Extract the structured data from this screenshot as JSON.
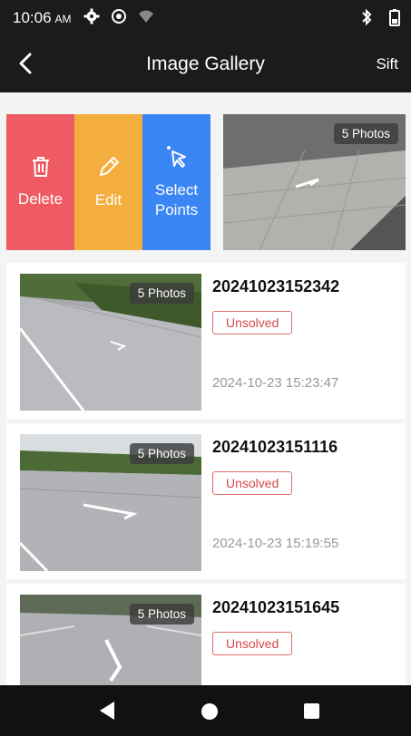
{
  "status_bar": {
    "time": "10:06",
    "ampm": "AM",
    "icons": [
      "gear-icon",
      "record-icon",
      "wifi-icon",
      "bluetooth-icon",
      "battery-icon"
    ]
  },
  "app_bar": {
    "title": "Image Gallery",
    "back_icon": "back-arrow-icon",
    "sift_label": "Sift"
  },
  "swipe_item": {
    "actions": [
      {
        "label": "Delete",
        "icon": "trash-icon",
        "color": "#ef5b62"
      },
      {
        "label": "Edit",
        "icon": "pencil-icon",
        "color": "#f4ae3d"
      },
      {
        "label": "Select\nPoints",
        "label_line1": "Select",
        "label_line2": "Points",
        "icon": "pointer-icon",
        "color": "#3a86f4"
      }
    ],
    "badge": "5 Photos"
  },
  "items": [
    {
      "code": "20241023152342",
      "status": "Unsolved",
      "time": "2024-10-23 15:23:47",
      "badge": "5 Photos"
    },
    {
      "code": "20241023151116",
      "status": "Unsolved",
      "time": "2024-10-23 15:19:55",
      "badge": "5 Photos"
    },
    {
      "code": "20241023151645",
      "status": "Unsolved",
      "time": "",
      "badge": "5 Photos"
    }
  ],
  "nav_bar": {
    "icons": [
      "back-triangle-icon",
      "home-circle-icon",
      "recents-square-icon"
    ]
  },
  "colors": {
    "bar_background": "#1b1b1b",
    "status_red": "#d64848",
    "delete": "#ef5b62",
    "edit": "#f4ae3d",
    "select": "#3a86f4"
  }
}
